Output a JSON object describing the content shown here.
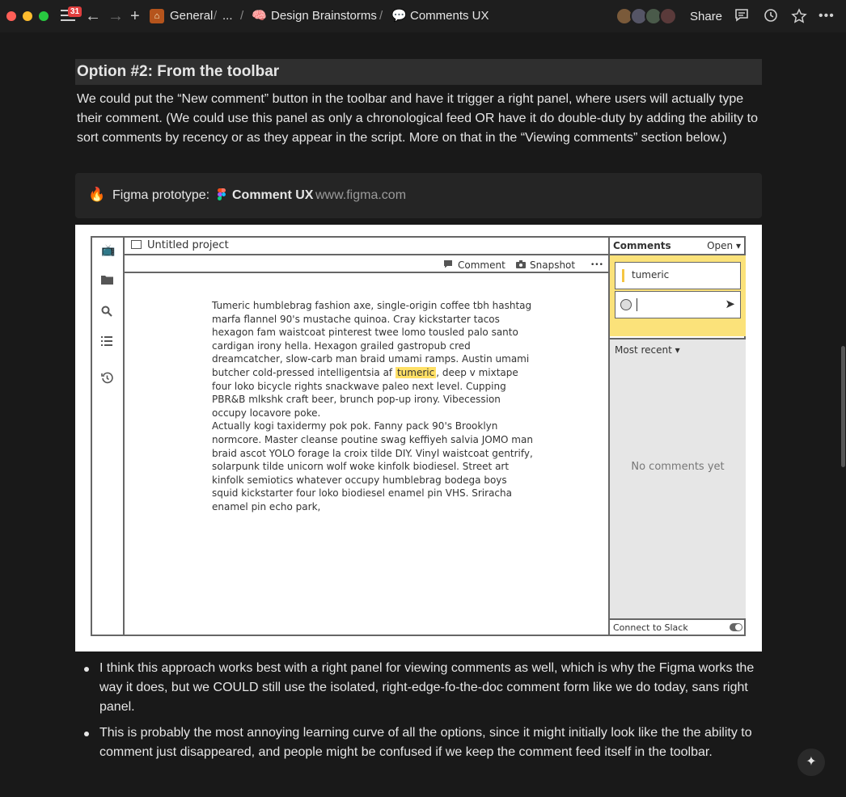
{
  "topbar": {
    "notification_count": "31",
    "breadcrumbs": [
      "General",
      "...",
      "Design Brainstorms",
      "Comments UX"
    ],
    "separators": [
      "/",
      "/",
      "/"
    ],
    "breadcrumb_icons": [
      "house-icon",
      "brain-icon",
      "speech-bubble-icon"
    ],
    "share_label": "Share"
  },
  "section": {
    "heading": "Option #2: From the toolbar",
    "paragraph": "We could put the “New comment” button in the toolbar and have it trigger a right panel, where users will actually type their comment. (We could use this panel as only a chronological feed OR have it do double-duty by adding the ability to sort comments by recency or as they appear in the script. More on that in the “Viewing comments” section below.)"
  },
  "bookmark": {
    "label": "Figma prototype:",
    "title": "Comment UX",
    "url": "www.figma.com"
  },
  "mockup": {
    "project_title": "Untitled project",
    "toolbar": {
      "comment": "Comment",
      "snapshot": "Snapshot",
      "more": "•••"
    },
    "body_before": "Tumeric humblebrag fashion axe, single-origin coffee tbh hashtag marfa flannel 90's mustache quinoa. Cray kickstarter tacos hexagon fam waistcoat pinterest twee lomo tousled palo santo cardigan irony hella. Hexagon grailed gastropub cred dreamcatcher, slow-carb man braid umami ramps. Austin umami butcher cold-pressed intelligentsia af ",
    "body_highlight": "tumeric",
    "body_after": ", deep v mixtape four loko bicycle rights snackwave paleo next level. Cupping PBR&B mlkshk craft beer, brunch pop-up irony. Vibecession occupy locavore poke.",
    "body_second": "Actually kogi taxidermy pok pok. Fanny pack 90's Brooklyn normcore. Master cleanse poutine swag keffiyeh salvia JOMO man braid ascot YOLO forage la croix tilde DIY. Vinyl waistcoat gentrify, solarpunk tilde unicorn wolf woke kinfolk biodiesel. Street art kinfolk semiotics whatever occupy humblebrag bodega boys squid kickstarter four loko biodiesel enamel pin VHS. Sriracha enamel pin echo park,",
    "panel": {
      "title": "Comments",
      "filter": "Open ▾",
      "quote": "tumeric",
      "sort": "Most recent ▾",
      "empty": "No comments yet",
      "slack": "Connect to Slack"
    }
  },
  "bullets": [
    "I think this approach works best with a right panel for viewing comments as well, which is why the Figma works the way it does, but we COULD still use the isolated, right-edge-fo-the-doc comment form like we do today, sans right panel.",
    "This is probably the most annoying learning curve of all the options, since it might initially look like the the ability to comment just disappeared, and people might be confused if we keep the comment feed itself in the toolbar."
  ],
  "colors": {
    "background": "#191919",
    "heading_bg": "#2f2f2f",
    "highlight": "#ffe066",
    "panel_yellow": "#fbe27a"
  }
}
